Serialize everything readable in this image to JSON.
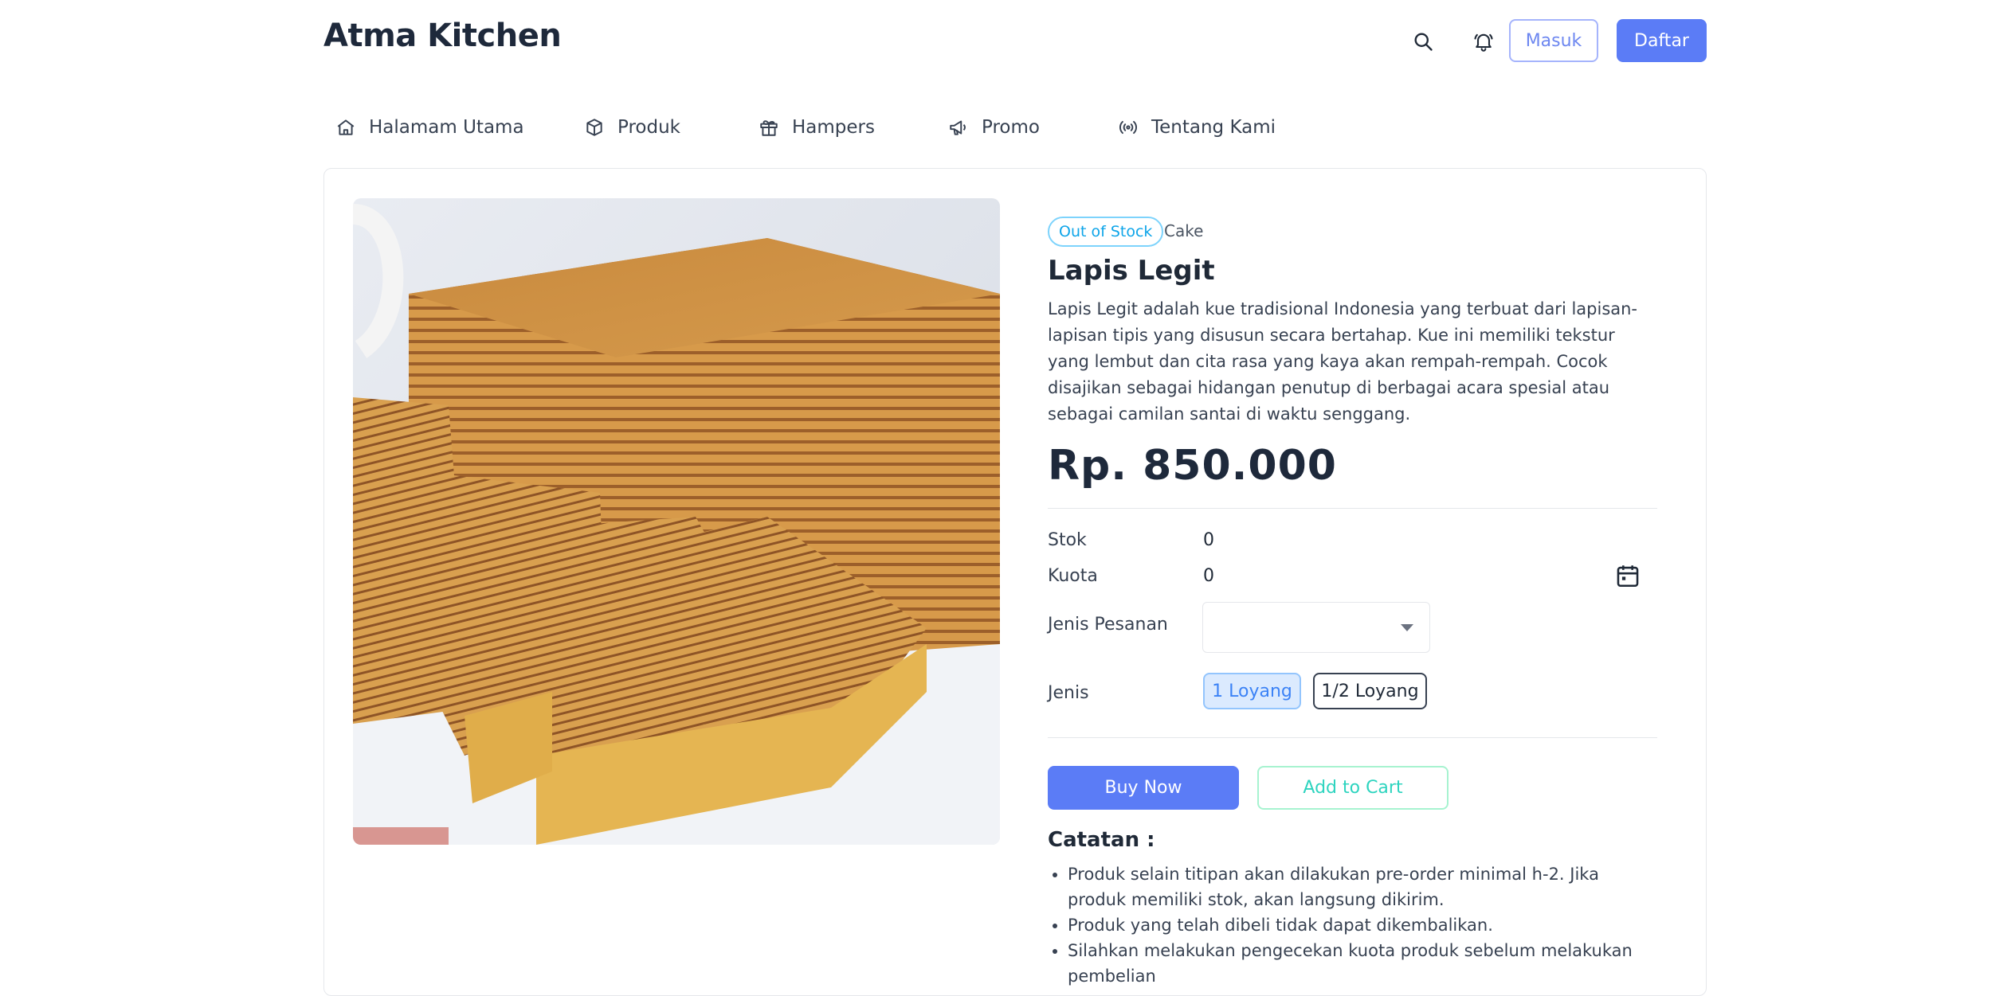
{
  "brand": "Atma Kitchen",
  "header": {
    "search_icon": "search-icon",
    "bell_icon": "bell-icon",
    "login_label": "Masuk",
    "register_label": "Daftar"
  },
  "nav": [
    {
      "label": "Halamam Utama",
      "icon": "home-icon"
    },
    {
      "label": "Produk",
      "icon": "box-icon"
    },
    {
      "label": "Hampers",
      "icon": "gift-icon"
    },
    {
      "label": "Promo",
      "icon": "megaphone-icon"
    },
    {
      "label": "Tentang Kami",
      "icon": "broadcast-icon"
    }
  ],
  "product": {
    "status_badge": "Out of Stock",
    "category": "Cake",
    "name": "Lapis Legit",
    "description": "Lapis Legit adalah kue tradisional Indonesia yang terbuat dari lapisan-lapisan tipis yang disusun secara bertahap. Kue ini memiliki tekstur yang lembut dan cita rasa yang kaya akan rempah-rempah. Cocok disajikan sebagai hidangan penutup di berbagai acara spesial atau sebagai camilan santai di waktu senggang.",
    "price": "Rp. 850.000",
    "image_alt": "lapis-legit-photo"
  },
  "details": {
    "stock_label": "Stok",
    "stock_value": "0",
    "quota_label": "Kuota",
    "quota_value": "0",
    "order_type_label": "Jenis Pesanan",
    "order_type_value": "",
    "variant_label": "Jenis",
    "variants": [
      "1 Loyang",
      "1/2 Loyang"
    ],
    "selected_variant": "1 Loyang"
  },
  "actions": {
    "buy_now": "Buy Now",
    "add_to_cart": "Add to Cart"
  },
  "notes": {
    "title": "Catatan :",
    "items": [
      "Produk selain titipan akan dilakukan pre-order minimal h-2. Jika produk memiliki stok, akan langsung dikirim.",
      "Produk yang telah dibeli tidak dapat dikembalikan.",
      "Silahkan melakukan pengecekan kuota produk sebelum melakukan pembelian"
    ]
  },
  "colors": {
    "primary": "#5b7cf6",
    "badge": "#0ea5e9",
    "cart": "#2dd4bf"
  }
}
